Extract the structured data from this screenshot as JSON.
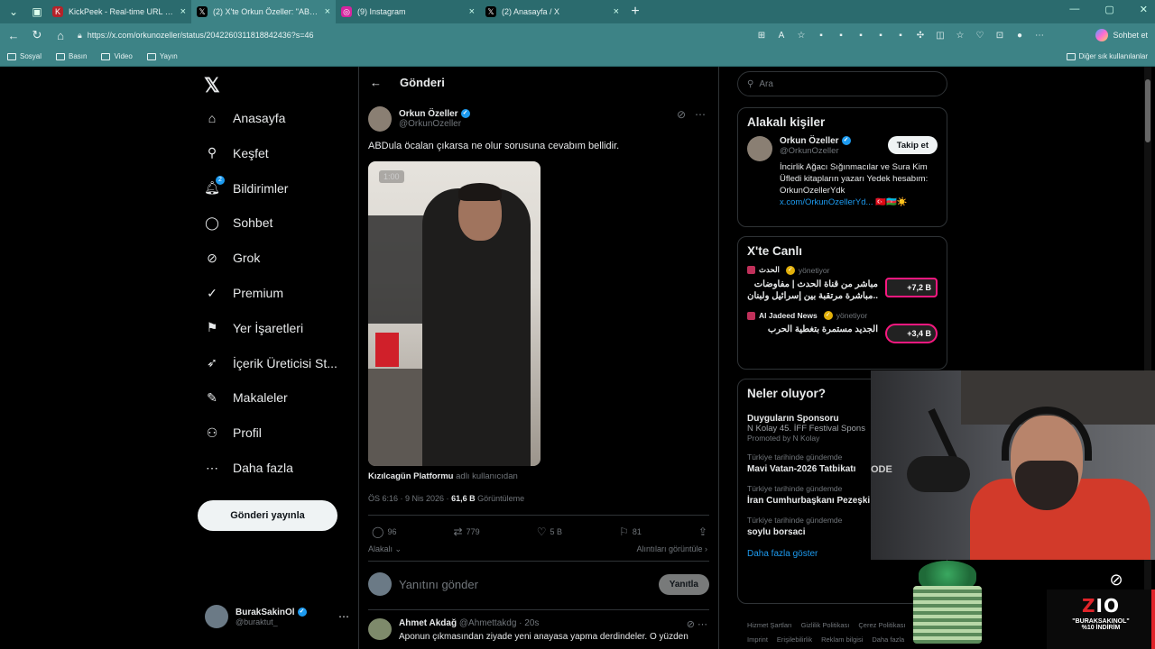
{
  "browser": {
    "tabs": [
      {
        "title": "KickPeek - Real-time URL Crawler",
        "icon": "kick-icon",
        "color": "#b4232a",
        "active": false
      },
      {
        "title": "(2) X'te Orkun Özeller: \"ABDula",
        "icon": "x-icon",
        "color": "#000000",
        "active": true
      },
      {
        "title": "(9) Instagram",
        "icon": "instagram-icon",
        "color": "#d6249f",
        "active": false
      },
      {
        "title": "(2) Anasayfa / X",
        "icon": "x-icon",
        "color": "#000000",
        "active": false
      }
    ],
    "url": "https://x.com/orkunozeller/status/2042260311818842436?s=46",
    "chat_label": "Sohbet et",
    "bookmarks": [
      "Sosyal",
      "Basın",
      "Video",
      "Yayın"
    ],
    "bookmarks_other": "Diğer sık kullanılanlar"
  },
  "nav": {
    "items": [
      {
        "label": "Anasayfa",
        "icon": "home-icon",
        "glyph": "⌂"
      },
      {
        "label": "Keşfet",
        "icon": "search-icon",
        "glyph": "⚲"
      },
      {
        "label": "Bildirimler",
        "icon": "bell-icon",
        "glyph": "🔔︎",
        "badge": "2"
      },
      {
        "label": "Sohbet",
        "icon": "chat-icon",
        "glyph": "◯"
      },
      {
        "label": "Grok",
        "icon": "grok-icon",
        "glyph": "⊘"
      },
      {
        "label": "Premium",
        "icon": "premium-icon",
        "glyph": "✓"
      },
      {
        "label": "Yer İşaretleri",
        "icon": "bookmark-icon",
        "glyph": "⚑"
      },
      {
        "label": "İçerik Üreticisi St...",
        "icon": "rocket-icon",
        "glyph": "➶"
      },
      {
        "label": "Makaleler",
        "icon": "article-icon",
        "glyph": "✎"
      },
      {
        "label": "Profil",
        "icon": "profile-icon",
        "glyph": "⚇"
      },
      {
        "label": "Daha fazla",
        "icon": "more-circle-icon",
        "glyph": "⋯"
      }
    ],
    "post_button": "Gönderi yayınla",
    "me": {
      "name": "BurakSakinOl",
      "handle": "@buraktut_"
    }
  },
  "main": {
    "title": "Gönderi",
    "author": {
      "name": "Orkun Özeller",
      "handle": "@OrkunOzeller"
    },
    "text": "ABDula öcalan çıkarsa ne olur sorusuna cevabım bellidir.",
    "video_time": "1:00",
    "source_name": "Kızılcagün Platformu",
    "source_suffix": "adlı kullanıcıdan",
    "time": "ÖS 6:16 · 9 Nis 2026 ·",
    "views": "61,6 B",
    "views_label": "Görüntüleme",
    "actions": {
      "replies": "96",
      "reposts": "779",
      "likes": "5 B",
      "bookmarks": "81"
    },
    "related": "Alakalı",
    "quotes": "Alıntıları görüntüle",
    "reply_placeholder": "Yanıtını gönder",
    "reply_button": "Yanıtla",
    "comment": {
      "name": "Ahmet Akdağ",
      "handle": "@Ahmettakdg · 20s",
      "text": "Aponun çıkmasından ziyade yeni anayasa yapma derdindeler. O yüzden"
    }
  },
  "sidebar": {
    "search_placeholder": "Ara",
    "related_title": "Alakalı kişiler",
    "related_person": {
      "name": "Orkun Özeller",
      "handle": "@OrkunOzeller",
      "follow": "Takip et",
      "bio": "İncirlik Ağacı Sığınmacılar ve Sura Kim Üfledi kitapların yazarı Yedek hesabım: OrkunOzellerYdk",
      "link": "x.com/OrkunOzellerYd...",
      "flags": "🇹🇷🇦🇿☀️"
    },
    "live_title": "X'te Canlı",
    "live": [
      {
        "source": "الحدث",
        "status": "yönetiyor",
        "title": "مباشر من قناة الحدث | مفاوضات مباشرة مرتقبة بين إسرائيل ولبنان..",
        "count": "+7,2 B"
      },
      {
        "source": "Al Jadeed News",
        "status": "yönetiyor",
        "title": "الجديد مستمرة بتغطية الحرب",
        "count": "+3,4 B"
      }
    ],
    "trends_title": "Neler oluyor?",
    "trends": [
      {
        "meta": "",
        "title": "Duyguların Sponsoru",
        "sub": "N Kolay 45. İFF Festival Spons",
        "promo": "Promoted by N Kolay"
      },
      {
        "meta": "Türkiye tarihinde gündemde",
        "title": "Mavi Vatan-2026 Tatbikatı"
      },
      {
        "meta": "Türkiye tarihinde gündemde",
        "title": "İran Cumhurbaşkanı Pezeşki"
      },
      {
        "meta": "Türkiye tarihinde gündemde",
        "title": "soylu borsaci"
      }
    ],
    "show_more": "Daha fazla göster",
    "footer": [
      "Hizmet Şartları",
      "Gizlilik Politikası",
      "Çerez Politikası",
      "Imprint",
      "Erişilebilirlik",
      "Reklam bilgisi",
      "Daha fazla"
    ]
  },
  "overlay": {
    "webcam_label": "ODE",
    "promo_logo_a": "Z",
    "promo_logo_b": "IO",
    "promo_code": "\"BURAKSAKINOL\"",
    "promo_discount": "%10 İNDİRİM"
  }
}
